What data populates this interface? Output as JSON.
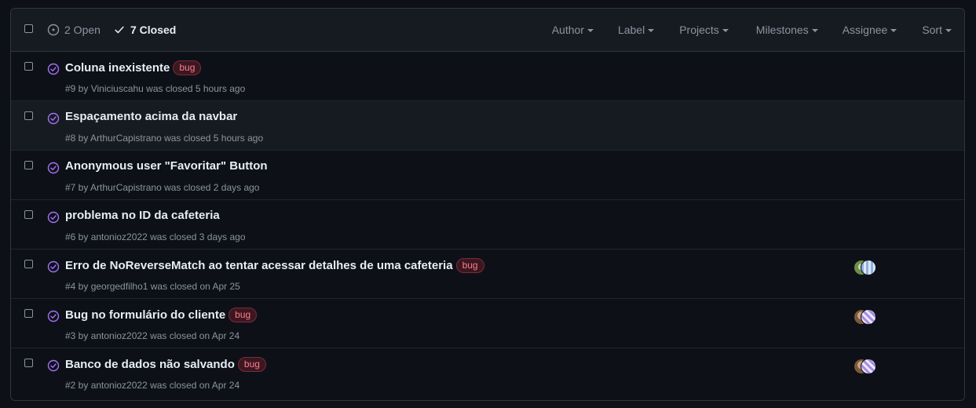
{
  "header": {
    "open_label": "2 Open",
    "closed_label": "7 Closed",
    "filters": [
      {
        "label": "Author"
      },
      {
        "label": "Label"
      },
      {
        "label": "Projects"
      },
      {
        "label": "Milestones"
      },
      {
        "label": "Assignee"
      },
      {
        "label": "Sort"
      }
    ]
  },
  "colors": {
    "closed_icon": "#a371f7",
    "bug_label_text": "#ff7b8e",
    "bug_label_bg": "#3b1720"
  },
  "issues": [
    {
      "title": "Coluna inexistente",
      "label": "bug",
      "meta": "#9 by Viniciuscahu was closed 5 hours ago"
    },
    {
      "title": "Espaçamento acima da navbar",
      "label": "",
      "meta": "#8 by ArthurCapistrano was closed 5 hours ago"
    },
    {
      "title": "Anonymous user \"Favoritar\" Button",
      "label": "",
      "meta": "#7 by ArthurCapistrano was closed 2 days ago"
    },
    {
      "title": "problema no ID da cafeteria",
      "label": "",
      "meta": "#6 by antonioz2022 was closed 3 days ago"
    },
    {
      "title": "Erro de NoReverseMatch ao tentar acessar detalhes de uma cafeteria",
      "label": "bug",
      "meta": "#4 by georgedfilho1 was closed on Apr 25"
    },
    {
      "title": "Bug no formulário do cliente",
      "label": "bug",
      "meta": "#3 by antonioz2022 was closed on Apr 24"
    },
    {
      "title": "Banco de dados não salvando",
      "label": "bug",
      "meta": "#2 by antonioz2022 was closed on Apr 24"
    }
  ]
}
